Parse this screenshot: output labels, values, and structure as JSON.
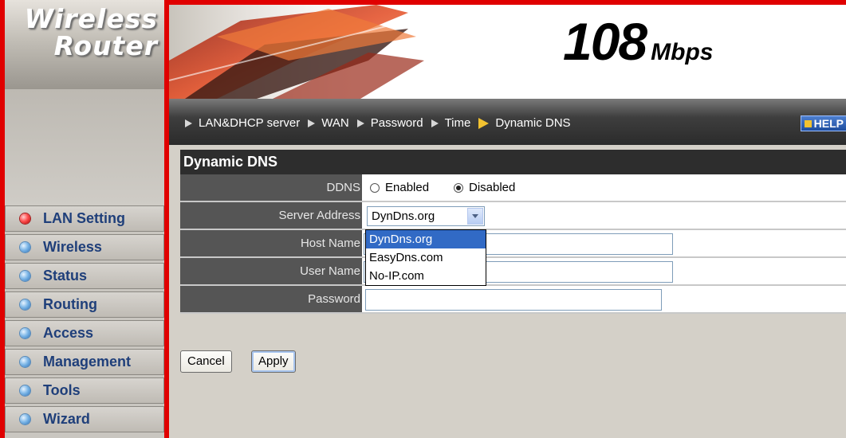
{
  "logo": {
    "line1": "Wireless",
    "line2": "Router"
  },
  "header": {
    "speed_number": "108",
    "speed_unit": "Mbps"
  },
  "nav": {
    "items": [
      "LAN&DHCP server",
      "WAN",
      "Password",
      "Time",
      "Dynamic DNS"
    ],
    "active": "Dynamic DNS",
    "help_label": "HELP"
  },
  "sidebar": {
    "items": [
      {
        "label": "LAN Setting",
        "active": true
      },
      {
        "label": "Wireless",
        "active": false
      },
      {
        "label": "Status",
        "active": false
      },
      {
        "label": "Routing",
        "active": false
      },
      {
        "label": "Access",
        "active": false
      },
      {
        "label": "Management",
        "active": false
      },
      {
        "label": "Tools",
        "active": false
      },
      {
        "label": "Wizard",
        "active": false
      }
    ]
  },
  "section": {
    "title": "Dynamic DNS"
  },
  "form": {
    "ddns": {
      "label": "DDNS",
      "option_enabled": "Enabled",
      "option_disabled": "Disabled",
      "selected": "Disabled"
    },
    "server_address": {
      "label": "Server Address",
      "value": "DynDns.org",
      "options": [
        "DynDns.org",
        "EasyDns.com",
        "No-IP.com"
      ],
      "dropdown_open": true
    },
    "host_name": {
      "label": "Host Name",
      "value": ""
    },
    "user_name": {
      "label": "User Name",
      "value": ""
    },
    "password": {
      "label": "Password",
      "value": ""
    }
  },
  "buttons": {
    "cancel": "Cancel",
    "apply": "Apply"
  },
  "colors": {
    "brand_red": "#e00000",
    "label_bg": "#555555",
    "title_bg": "#2d2d2d",
    "menu_text": "#1f3f7a",
    "selection": "#316ac5"
  }
}
